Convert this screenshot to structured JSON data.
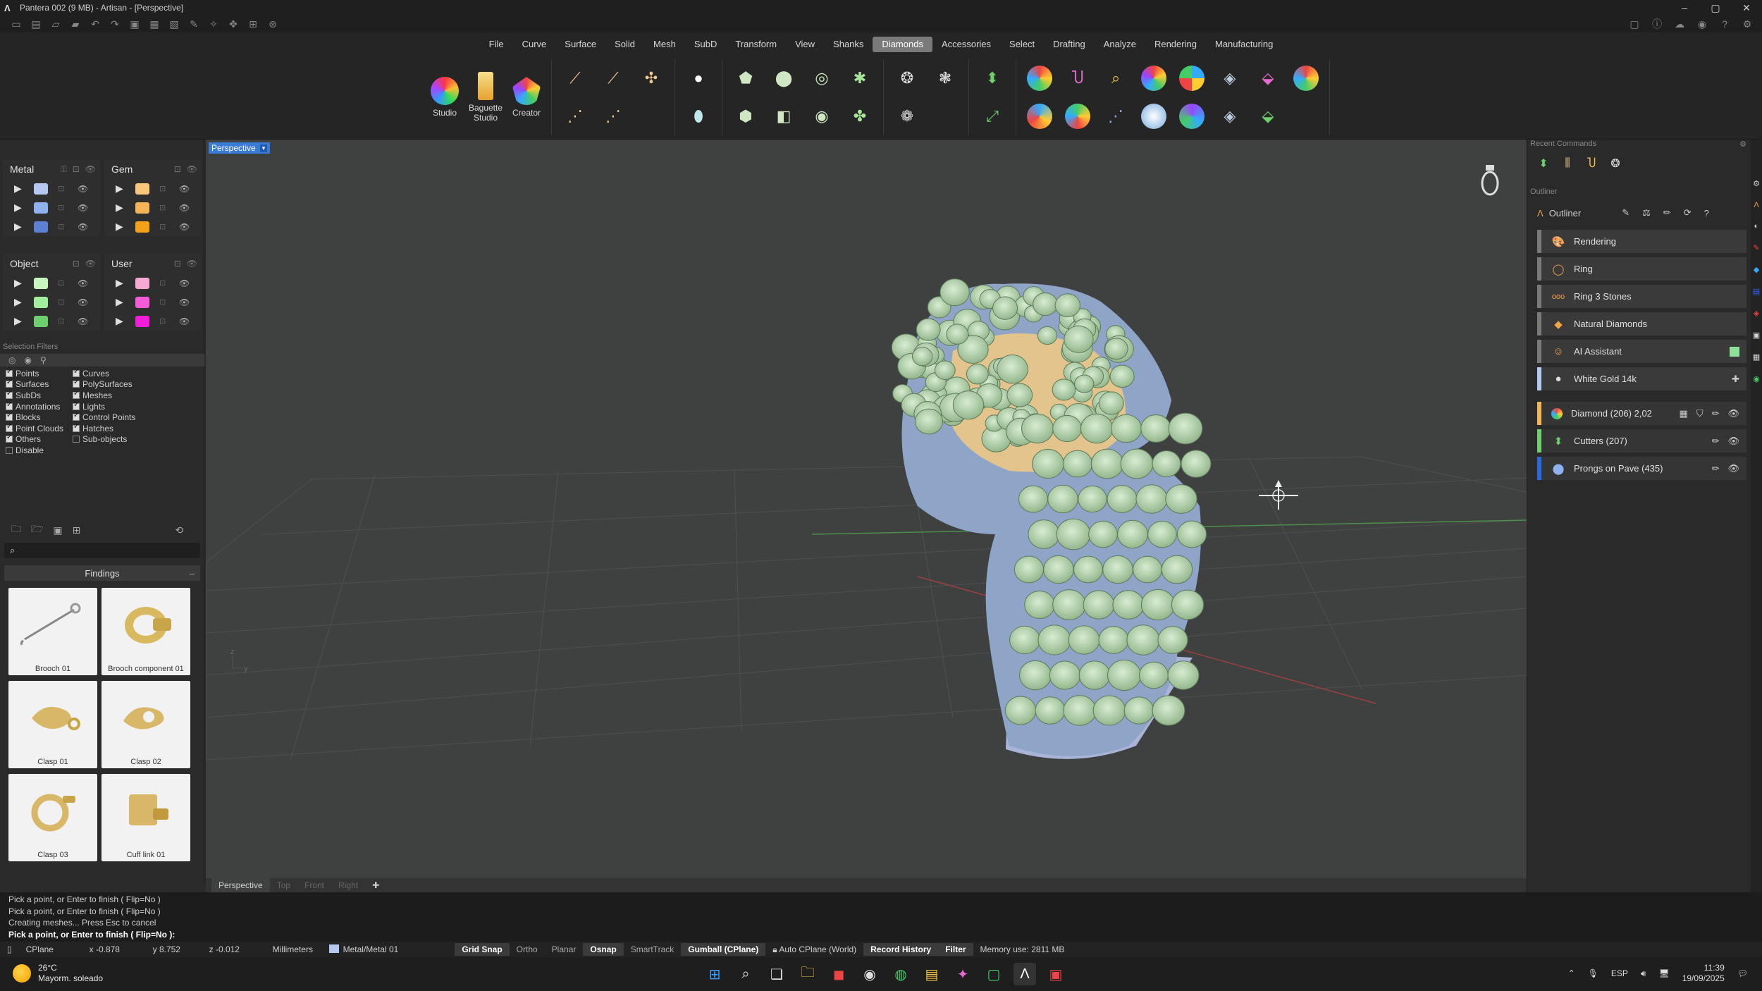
{
  "window": {
    "title": "Pantera 002 (9 MB) - Artisan - [Perspective]",
    "controls": [
      "–",
      "▢",
      "✕"
    ]
  },
  "menu": [
    "File",
    "Curve",
    "Surface",
    "Solid",
    "Mesh",
    "SubD",
    "Transform",
    "View",
    "Shanks",
    "Diamonds",
    "Accessories",
    "Select",
    "Drafting",
    "Analyze",
    "Rendering",
    "Manufacturing"
  ],
  "menu_active": "Diamonds",
  "ribbon": {
    "studio_label": "Studio",
    "baguette_label": "Baguette Studio",
    "creator_label": "Creator"
  },
  "layers": {
    "metal": {
      "title": "Metal",
      "colors": [
        "#b3c9f2",
        "#8fb1ef",
        "#5d7fd4"
      ]
    },
    "gem": {
      "title": "Gem",
      "colors": [
        "#f7c77c",
        "#f3b558",
        "#f1a21a"
      ]
    },
    "object": {
      "title": "Object",
      "colors": [
        "#c8f5c0",
        "#a2ed9e",
        "#6fce6e"
      ]
    },
    "user": {
      "title": "User",
      "colors": [
        "#f6a9d2",
        "#f35bd9",
        "#f31cd8"
      ]
    }
  },
  "selection_filters": {
    "title": "Selection Filters",
    "left": [
      {
        "label": "Points",
        "checked": true
      },
      {
        "label": "Surfaces",
        "checked": true
      },
      {
        "label": "SubDs",
        "checked": true
      },
      {
        "label": "Annotations",
        "checked": true
      },
      {
        "label": "Blocks",
        "checked": true
      },
      {
        "label": "Point Clouds",
        "checked": true
      },
      {
        "label": "Others",
        "checked": true
      },
      {
        "label": "Disable",
        "checked": false
      }
    ],
    "right": [
      {
        "label": "Curves",
        "checked": true
      },
      {
        "label": "PolySurfaces",
        "checked": true
      },
      {
        "label": "Meshes",
        "checked": true
      },
      {
        "label": "Lights",
        "checked": true
      },
      {
        "label": "Control Points",
        "checked": true
      },
      {
        "label": "Hatches",
        "checked": true
      },
      {
        "label": "Sub-objects",
        "checked": false
      }
    ]
  },
  "library": {
    "section": "Findings",
    "items": [
      "Brooch 01",
      "Brooch component 01",
      "Clasp 01",
      "Clasp 02",
      "Clasp 03",
      "Cuff link 01"
    ]
  },
  "viewport": {
    "active": "Perspective",
    "tabs": [
      "Perspective",
      "Top",
      "Front",
      "Right"
    ],
    "axis_label_y": "y",
    "axis_label_z": "z"
  },
  "recent_commands": {
    "title": "Recent Commands"
  },
  "outliner": {
    "section_title": "Outliner",
    "header": "Outliner",
    "items": [
      {
        "label": "Rendering",
        "icon": "🎨",
        "stripe": "#7a7a7a"
      },
      {
        "label": "Ring",
        "icon": "◯",
        "stripe": "#7a7a7a"
      },
      {
        "label": "Ring 3 Stones",
        "icon": "ooo",
        "stripe": "#7a7a7a"
      },
      {
        "label": "Natural Diamonds",
        "icon": "◆",
        "stripe": "#7a7a7a"
      },
      {
        "label": "AI Assistant",
        "icon": "☺",
        "stripe": "#7a7a7a"
      },
      {
        "label": "White Gold 14k",
        "icon": "●",
        "stripe": "#b3c9f2"
      }
    ],
    "layers": [
      {
        "label": "Diamond (206) 2,02",
        "stripe": "#f3b558"
      },
      {
        "label": "Cutters (207)",
        "stripe": "#6fce6e"
      },
      {
        "label": "Prongs on Pave (435)",
        "stripe": "#2a6ae0"
      }
    ]
  },
  "command_history": [
    "Pick a point, or Enter to finish ( Flip=No )",
    "Pick a point, or Enter to finish ( Flip=No )",
    "Creating meshes... Press Esc to cancel"
  ],
  "command_prompt": "Pick a point, or Enter to finish ( Flip=No ):",
  "status": {
    "cplane": "CPlane",
    "x": "x -0.878",
    "y": "y 8.752",
    "z": "z -0.012",
    "units": "Millimeters",
    "layer": "Metal/Metal 01",
    "grid_snap": "Grid Snap",
    "ortho": "Ortho",
    "planar": "Planar",
    "osnap": "Osnap",
    "smarttrack": "SmartTrack",
    "gumball": "Gumball (CPlane)",
    "auto_cplane": "Auto CPlane (World)",
    "record_history": "Record History",
    "filter": "Filter",
    "memory": "Memory use: 2811 MB"
  },
  "taskbar": {
    "temp": "26°C",
    "weather": "Mayorm. soleado",
    "lang": "ESP",
    "time": "11:39",
    "date": "19/09/2025"
  }
}
